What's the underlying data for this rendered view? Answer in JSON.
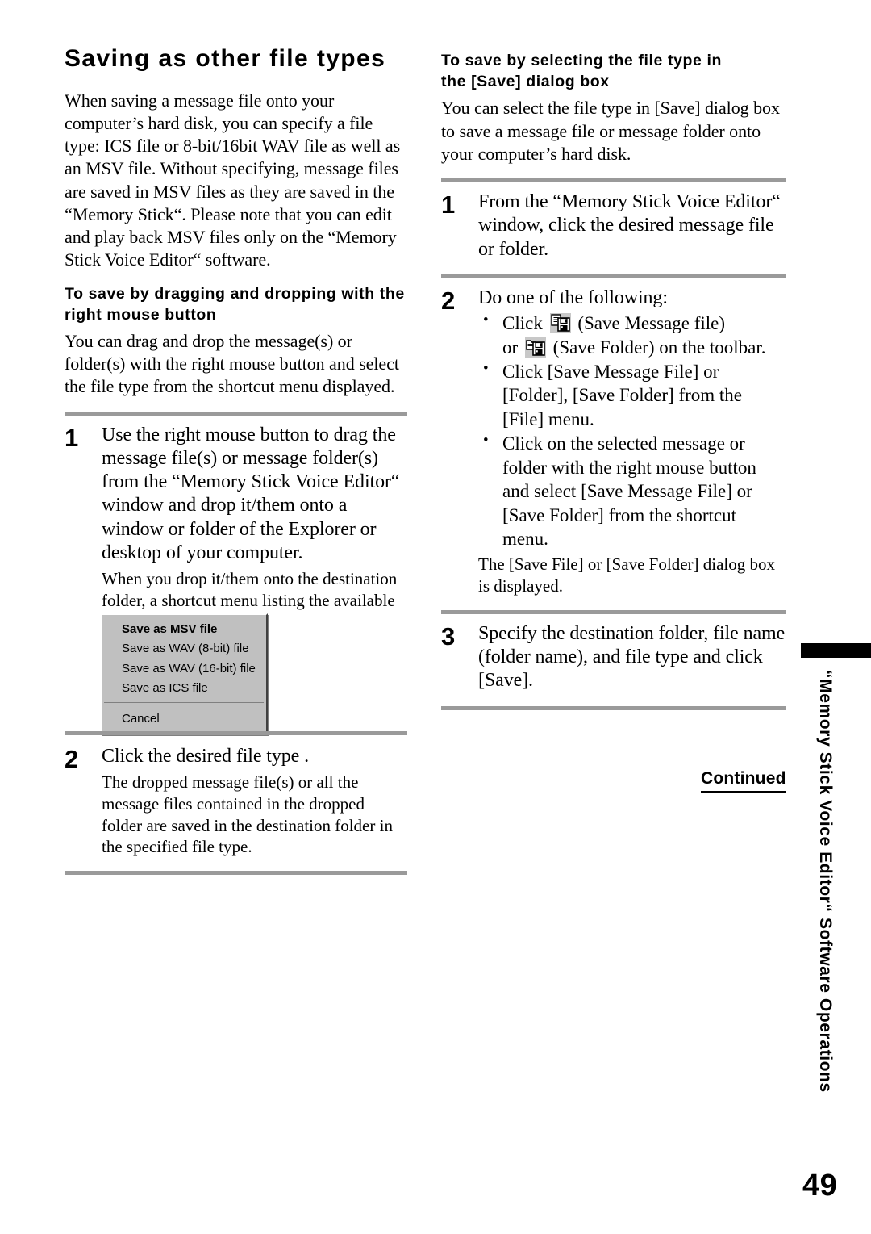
{
  "page": {
    "number": "49",
    "side_tab_text": "“Memory Stick Voice Editor“ Software Operations",
    "continued_label": "Continued"
  },
  "left_column": {
    "title": "Saving as other file types",
    "intro": "When saving a message file onto your computer’s hard disk, you can specify a file type: ICS file or 8-bit/16bit WAV file as well as an MSV file.  Without specifying, message files are saved in MSV files as they are saved in the “Memory Stick“.  Please note that you can edit and play back MSV files only on the “Memory Stick Voice Editor“ software.",
    "section_heading": "To save by dragging and dropping with the right mouse button",
    "section_intro": "You can drag and drop the message(s) or folder(s) with the right mouse button and select the file type from the shortcut menu displayed.",
    "steps": [
      {
        "number": "1",
        "lead": "Use the right mouse button to drag the message file(s) or message folder(s) from the “Memory Stick Voice Editor“ window and drop it/them onto a window or folder of the Explorer or desktop of your computer.",
        "sub": "When you drop it/them onto the destination folder, a shortcut menu listing the available file types is displayed."
      },
      {
        "number": "2",
        "lead": "Click the desired file type .",
        "sub": "The dropped message file(s) or all the message files contained in the dropped folder are saved in the destination folder in the specified file type."
      }
    ],
    "context_menu": {
      "items": [
        "Save as MSV file",
        "Save as WAV (8-bit) file",
        "Save as WAV (16-bit) file",
        "Save as ICS file"
      ],
      "cancel": "Cancel"
    }
  },
  "right_column": {
    "section_heading_line1": "To save by selecting the file type in",
    "section_heading_line2": "the [Save] dialog box",
    "section_intro": "You can select the file type in [Save] dialog box to save a message file or message folder onto your computer’s hard disk.",
    "steps": [
      {
        "number": "1",
        "lead": "From the “Memory Stick Voice Editor“ window, click the desired message file or folder."
      },
      {
        "number": "2",
        "lead": "Do one of the following:",
        "bullets": [
          {
            "text_before_icon": "Click",
            "icon1_label": "(Save Message file)",
            "text_middle": "or",
            "icon2_label": "(Save Folder) on the toolbar."
          },
          {
            "text": "Click [Save Message File] or [Folder],  [Save Folder] from the [File] menu."
          },
          {
            "text": "Click on the selected message or folder with the right mouse button and select [Save Message File] or [Save Folder] from the shortcut menu."
          }
        ],
        "note": "The [Save File] or [Save Folder] dialog box is displayed."
      },
      {
        "number": "3",
        "lead": "Specify the destination folder, file name (folder name), and file type and click [Save]."
      }
    ]
  },
  "colors": {
    "rule": "#9a9a9a",
    "menu_face": "#c0c0c0",
    "icon_bg": "#c8c8c8",
    "black": "#000000"
  }
}
